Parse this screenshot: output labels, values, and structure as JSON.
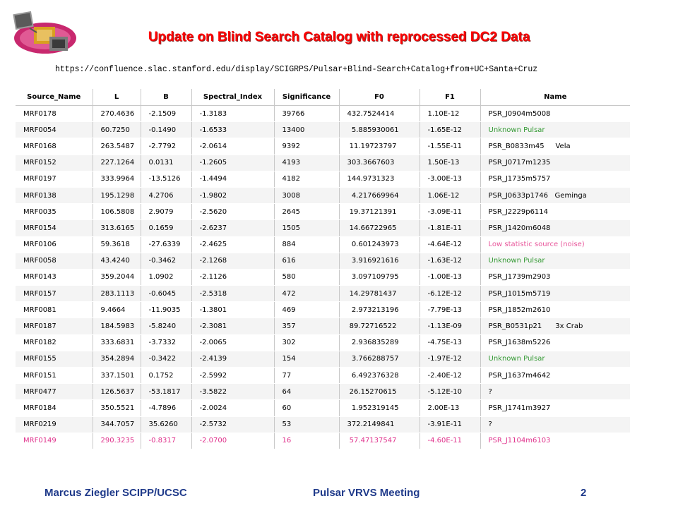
{
  "slide": {
    "title": "Update on Blind Search Catalog with reprocessed DC2 Data",
    "url": "https://confluence.slac.stanford.edu/display/SCIGRPS/Pulsar+Blind-Search+Catalog+from+UC+Santa+Cruz",
    "logo_icon": "satellite-logo-icon"
  },
  "table": {
    "headers": [
      "Source_Name",
      "L",
      "B",
      "Spectral_Index",
      "Significance",
      "F0",
      "F1",
      "Name"
    ],
    "rows": [
      [
        "MRF0178",
        "270.4636",
        "-2.1509",
        "-1.3183",
        "39766",
        "432.7524414",
        "1.10E-12",
        "PSR_J0904m5008"
      ],
      [
        "MRF0054",
        "60.7250",
        "-0.1490",
        "-1.6533",
        "13400",
        "  5.885930061",
        "-1.65E-12",
        "Unknown Pulsar"
      ],
      [
        "MRF0168",
        "263.5487",
        "-2.7792",
        "-2.0614",
        "9392",
        " 11.19723797",
        "-1.55E-11",
        "PSR_B0833m45     Vela"
      ],
      [
        "MRF0152",
        "227.1264",
        "0.0131",
        "-1.2605",
        "4193",
        "303.3667603",
        "1.50E-13",
        "PSR_J0717m1235"
      ],
      [
        "MRF0197",
        "333.9964",
        "-13.5126",
        "-1.4494",
        "4182",
        "144.9731323",
        "-3.00E-13",
        "PSR_J1735m5757"
      ],
      [
        "MRF0138",
        "195.1298",
        "4.2706",
        "-1.9802",
        "3008",
        "  4.217669964",
        "1.06E-12",
        "PSR_J0633p1746   Geminga"
      ],
      [
        "MRF0035",
        "106.5808",
        "2.9079",
        "-2.5620",
        "2645",
        " 19.37121391",
        "-3.09E-11",
        "PSR_J2229p6114"
      ],
      [
        "MRF0154",
        "313.6165",
        "0.1659",
        "-2.6237",
        "1505",
        " 14.66722965",
        "-1.81E-11",
        "PSR_J1420m6048"
      ],
      [
        "MRF0106",
        "59.3618",
        "-27.6339",
        "-2.4625",
        "884",
        "  0.601243973",
        "-4.64E-12",
        "Low statistic source (noise)"
      ],
      [
        "MRF0058",
        "43.4240",
        "-0.3462",
        "-2.1268",
        "616",
        "  3.916921616",
        "-1.63E-12",
        "Unknown Pulsar"
      ],
      [
        "MRF0143",
        "359.2044",
        "1.0902",
        "-2.1126",
        "580",
        "  3.097109795",
        "-1.00E-13",
        "PSR_J1739m2903"
      ],
      [
        "MRF0157",
        "283.1113",
        "-0.6045",
        "-2.5318",
        "472",
        " 14.29781437",
        "-6.12E-12",
        "PSR_J1015m5719"
      ],
      [
        "MRF0081",
        "9.4664",
        "-11.9035",
        "-1.3801",
        "469",
        "  2.973213196",
        "-7.79E-13",
        "PSR_J1852m2610"
      ],
      [
        "MRF0187",
        "184.5983",
        "-5.8240",
        "-2.3081",
        "357",
        " 89.72716522",
        "-1.13E-09",
        "PSR_B0531p21      3x Crab"
      ],
      [
        "MRF0182",
        "333.6831",
        "-3.7332",
        "-2.0065",
        "302",
        "  2.936835289",
        "-4.75E-13",
        "PSR_J1638m5226"
      ],
      [
        "MRF0155",
        "354.2894",
        "-0.3422",
        "-2.4139",
        "154",
        "  3.766288757",
        "-1.97E-12",
        "Unknown Pulsar"
      ],
      [
        "MRF0151",
        "337.1501",
        "0.1752",
        "-2.5992",
        "77",
        "  6.492376328",
        "-2.40E-12",
        "PSR_J1637m4642"
      ],
      [
        "MRF0477",
        "126.5637",
        "-53.1817",
        "-3.5822",
        "64",
        " 26.15270615",
        "-5.12E-10",
        "?"
      ],
      [
        "MRF0184",
        "350.5521",
        "-4.7896",
        "-2.0024",
        "60",
        "  1.952319145",
        "2.00E-13",
        "PSR_J1741m3927"
      ],
      [
        "MRF0219",
        "344.7057",
        "35.6260",
        "-2.5732",
        "53",
        "372.2149841",
        "-3.91E-11",
        "?"
      ],
      [
        "MRF0149",
        "290.3235",
        "-0.8317",
        "-2.0700",
        "16",
        " 57.47137547",
        "-4.60E-11",
        "PSR_J1104m6103"
      ]
    ],
    "name_colors": {
      "unknown_pulsar": "#339933",
      "low_statistic": "#e8559a",
      "highlight_row": "#e0318c"
    }
  },
  "footer": {
    "author": "Marcus Ziegler SCIPP/UCSC",
    "meeting": "Pulsar VRVS Meeting",
    "page": "2"
  }
}
